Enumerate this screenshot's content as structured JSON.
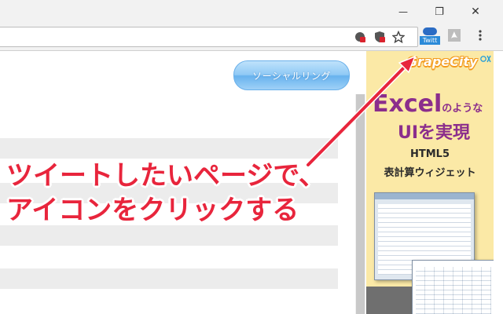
{
  "window": {
    "minimize_glyph": "—",
    "restore_glyph": "❐",
    "close_glyph": "✕"
  },
  "toolbar": {
    "extension_label": "Twitt",
    "icons": [
      "shield-icon",
      "adblock-icon",
      "star-icon",
      "twitter-extension-icon",
      "pdf-extension-icon",
      "menu-icon"
    ]
  },
  "page": {
    "social_button_label": "ソーシャルリング"
  },
  "ad": {
    "logo": "GrapeCity",
    "title_main": "Excel",
    "title_tail": "のような",
    "subtitle": "UIを実現",
    "line1": "HTML5",
    "line2": "表計算ウィジェット"
  },
  "annotation": {
    "line1": "ツイートしたいページで、",
    "line2": "アイコンをクリックする",
    "color": "#e8253c"
  }
}
